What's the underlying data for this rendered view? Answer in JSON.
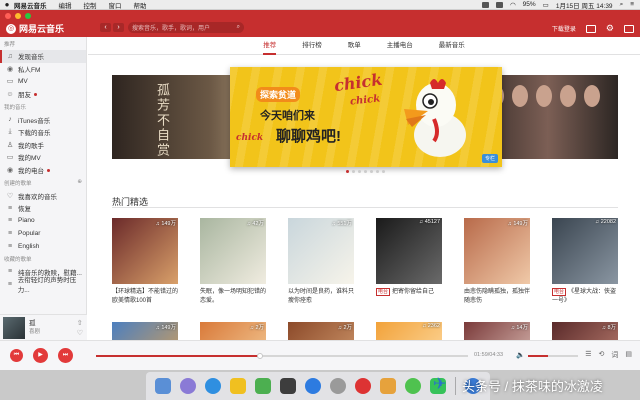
{
  "menubar": {
    "apple": "",
    "items": [
      "网易云音乐",
      "编辑",
      "控制",
      "窗口",
      "帮助"
    ],
    "battery": "95%",
    "datetime": "1月15日 周五 14:39"
  },
  "header": {
    "app_name": "网易云音乐",
    "search_placeholder": "搜索音乐，歌手，歌词，用户",
    "login": "下载登录",
    "colors": {
      "brand": "#c62f2f"
    }
  },
  "sidebar": {
    "sections": [
      {
        "title": "推荐",
        "items": [
          {
            "label": "发现音乐",
            "icon": "music-note-icon",
            "active": true
          },
          {
            "label": "私人FM",
            "icon": "radio-icon"
          },
          {
            "label": "MV",
            "icon": "video-icon"
          },
          {
            "label": "朋友",
            "icon": "friends-icon",
            "dot": true
          }
        ]
      },
      {
        "title": "我的音乐",
        "items": [
          {
            "label": "iTunes音乐",
            "icon": "itunes-icon"
          },
          {
            "label": "下载的音乐",
            "icon": "download-icon"
          },
          {
            "label": "我的歌手",
            "icon": "singer-icon"
          },
          {
            "label": "我的MV",
            "icon": "video-icon"
          },
          {
            "label": "我的电台",
            "icon": "radio-icon",
            "dot": true
          }
        ]
      },
      {
        "title": "创建的歌单",
        "items": [
          {
            "label": "我喜欢的音乐",
            "icon": "heart-icon"
          },
          {
            "label": "恢复",
            "icon": "playlist-icon"
          },
          {
            "label": "Piano",
            "icon": "playlist-icon"
          },
          {
            "label": "Popular",
            "icon": "playlist-icon"
          },
          {
            "label": "English",
            "icon": "playlist-icon"
          }
        ]
      },
      {
        "title": "收藏的歌单",
        "items": [
          {
            "label": "纯音乐的救赎，慰藉...",
            "icon": "playlist-icon"
          },
          {
            "label": "去衔轻灯的声势时压力...",
            "icon": "playlist-icon"
          }
        ]
      }
    ],
    "now_playing": {
      "title": "孤",
      "artist": "喜剧"
    }
  },
  "tabs": [
    {
      "label": "推荐",
      "active": true
    },
    {
      "label": "排行榜"
    },
    {
      "label": "歌单"
    },
    {
      "label": "主播电台"
    },
    {
      "label": "最新音乐"
    }
  ],
  "banner": {
    "tag": "探索贫道",
    "chick_big": "chick",
    "chick_small": "chick",
    "line1": "今天咱们来",
    "chick_side": "chick",
    "line2": "聊聊鸡吧!",
    "badge": "专栏",
    "left_art_text": "孤芳不自赏"
  },
  "hot": {
    "title": "热门精选",
    "cards": [
      {
        "count": "149万",
        "caption": "【环球精选】不能错过的欧美情歌100首",
        "c1": "#6b2a2a",
        "c2": "#d9a06a"
      },
      {
        "count": "42万",
        "caption": "失眠，像一场明知犯错的恋爱。",
        "c1": "#a9b6a0",
        "c2": "#f0ece0"
      },
      {
        "count": "551万",
        "caption": "以为时间是良药，谁料只瘦你痊愈",
        "c1": "#c9d6dc",
        "c2": "#f7f4ea"
      },
      {
        "count": "45127",
        "caption": "把寄你留给自己",
        "src": "电台",
        "c1": "#1a1a1a",
        "c2": "#6a6a6a"
      },
      {
        "count": "149万",
        "caption": "由悲伤隐瞒孤独，孤独伴随悲伤",
        "c1": "#b86a4a",
        "c2": "#f0c9a8"
      },
      {
        "count": "22082",
        "caption": "《星球大战：侠盗一号》",
        "src": "电台",
        "c1": "#3a4550",
        "c2": "#8a96a2"
      },
      {
        "count": "149万",
        "caption": "",
        "c1": "#4c7fbf",
        "c2": "#e7a44a"
      },
      {
        "count": "2万",
        "caption": "",
        "c1": "#d97a3a",
        "c2": "#f7d7a5"
      },
      {
        "count": "2万",
        "caption": "",
        "c1": "#8c4a2a",
        "c2": "#d9a476"
      },
      {
        "count": "2362",
        "caption": "",
        "c1": "#f2a23a",
        "c2": "#ffe3b0"
      },
      {
        "count": "14万",
        "caption": "",
        "c1": "#7a3a3a",
        "c2": "#e9cfc6"
      },
      {
        "count": "8万",
        "caption": "",
        "c1": "#5a2a2a",
        "c2": "#c98a7a"
      }
    ]
  },
  "player": {
    "time": "01:59/04:33",
    "progress": 0.44,
    "volume": 0.4
  },
  "watermark": "头条号 / 抹茶味的冰激凌"
}
